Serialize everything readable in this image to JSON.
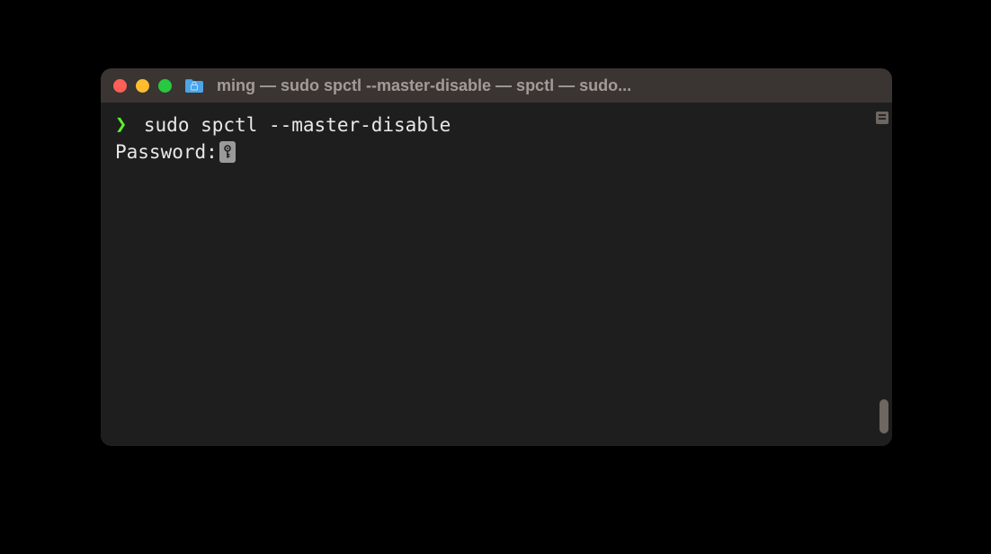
{
  "window": {
    "title": "ming — sudo spctl --master-disable — spctl — sudo..."
  },
  "terminal": {
    "prompt_symbol": "❯",
    "command": " sudo spctl --master-disable",
    "password_label": "Password:"
  },
  "colors": {
    "background": "#000000",
    "terminal_bg": "#1e1e1e",
    "titlebar_bg": "#3a3432",
    "title_text": "#a49b96",
    "prompt_green": "#5af12b",
    "text": "#e8e8e8",
    "close": "#ff5f57",
    "minimize": "#febc2e",
    "maximize": "#28c840"
  }
}
